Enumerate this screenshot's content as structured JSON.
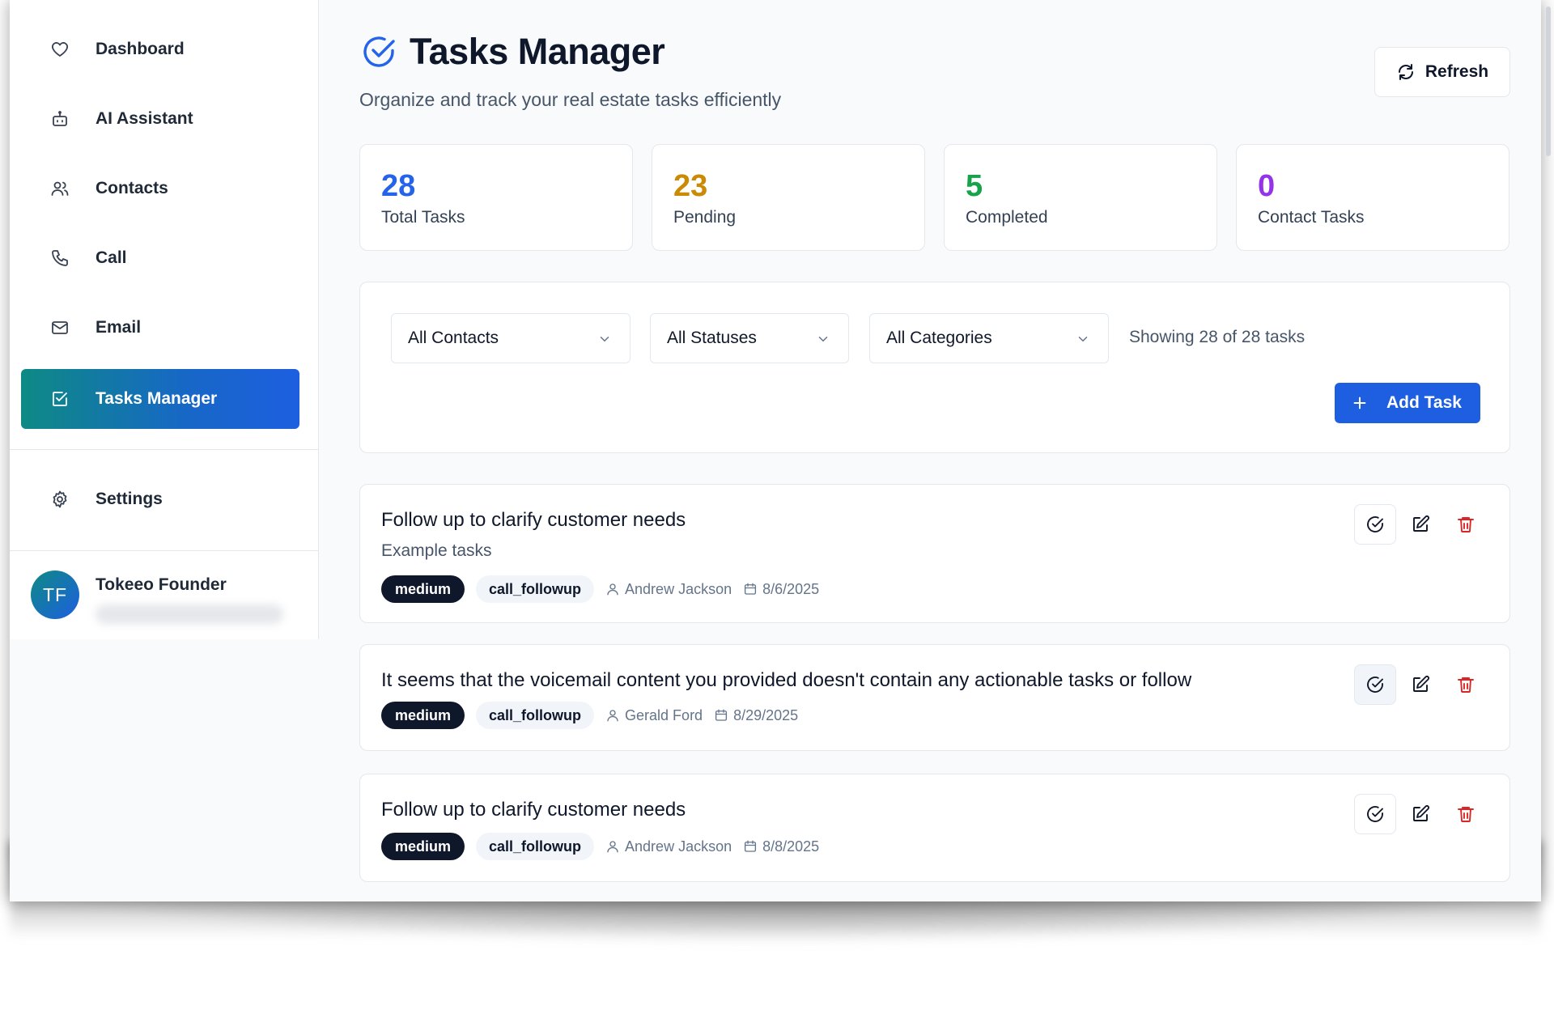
{
  "sidebar": {
    "items": [
      {
        "label": "Dashboard",
        "icon": "heart-icon"
      },
      {
        "label": "AI Assistant",
        "icon": "robot-icon"
      },
      {
        "label": "Contacts",
        "icon": "users-icon"
      },
      {
        "label": "Call",
        "icon": "phone-icon"
      },
      {
        "label": "Email",
        "icon": "mail-icon"
      },
      {
        "label": "Tasks Manager",
        "icon": "checkbox-icon",
        "active": true
      }
    ],
    "settings_label": "Settings",
    "user": {
      "initials": "TF",
      "name": "Tokeeo Founder"
    }
  },
  "header": {
    "title": "Tasks Manager",
    "subtitle": "Organize and track your real estate tasks efficiently",
    "refresh_label": "Refresh"
  },
  "stats": [
    {
      "value": "28",
      "label": "Total Tasks",
      "color": "#2563eb"
    },
    {
      "value": "23",
      "label": "Pending",
      "color": "#ca8a04"
    },
    {
      "value": "5",
      "label": "Completed",
      "color": "#16a34a"
    },
    {
      "value": "0",
      "label": "Contact Tasks",
      "color": "#9333ea"
    }
  ],
  "filters": {
    "contacts": "All Contacts",
    "statuses": "All Statuses",
    "categories": "All Categories",
    "showing": "Showing 28 of 28 tasks",
    "add_label": "Add Task"
  },
  "tasks": [
    {
      "title": "Follow up to clarify customer needs",
      "description": "Example tasks",
      "priority": "medium",
      "category": "call_followup",
      "contact": "Andrew Jackson",
      "date": "8/6/2025"
    },
    {
      "title": "It seems that the voicemail content you provided doesn't contain any actionable tasks or follow",
      "description": "",
      "priority": "medium",
      "category": "call_followup",
      "contact": "Gerald Ford",
      "date": "8/29/2025"
    },
    {
      "title": "Follow up to clarify customer needs",
      "description": "",
      "priority": "medium",
      "category": "call_followup",
      "contact": "Andrew Jackson",
      "date": "8/8/2025"
    }
  ],
  "colors": {
    "accent": "#1d5fe0",
    "teal": "#0e8a84",
    "danger": "#dc2626"
  }
}
